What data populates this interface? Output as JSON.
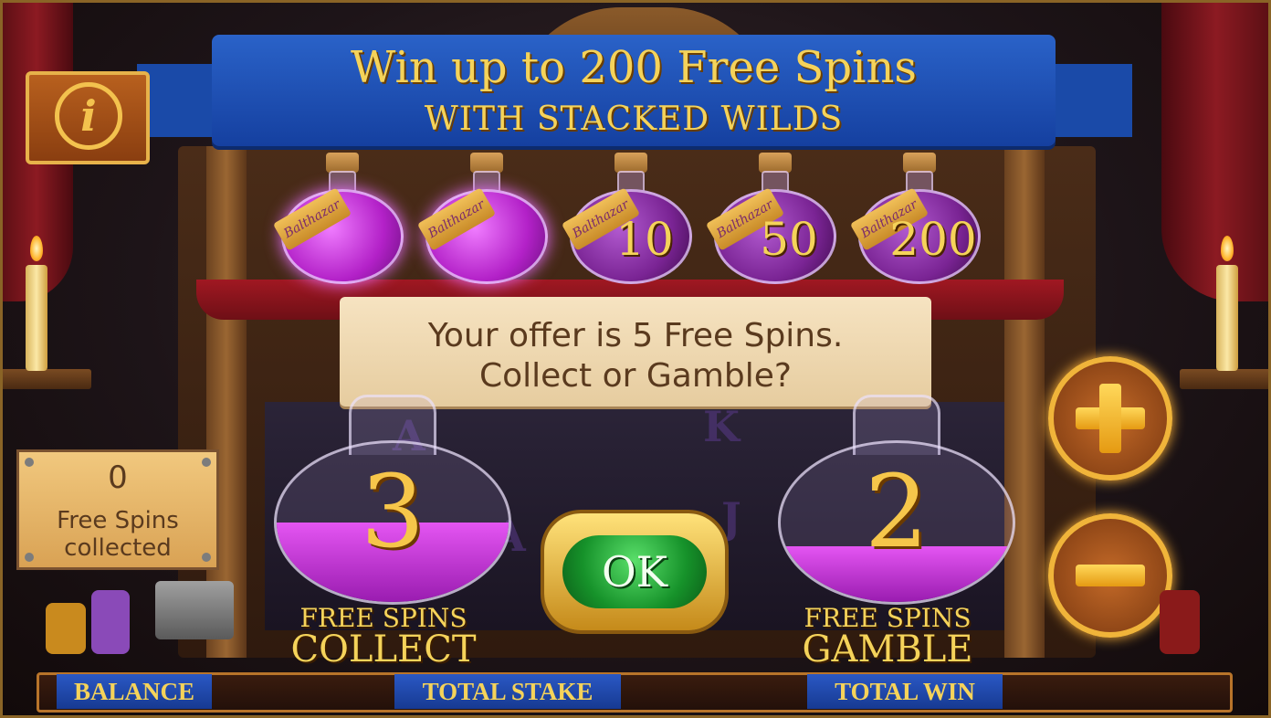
{
  "banner": {
    "title": "Win up to 200 Free Spins",
    "subtitle": "WITH STACKED WILDS"
  },
  "info_button": {
    "symbol": "i",
    "icon": "info-icon"
  },
  "potions": [
    {
      "state": "collected",
      "tag": "Balthazar",
      "value": ""
    },
    {
      "state": "collected",
      "tag": "Balthazar",
      "value": ""
    },
    {
      "state": "available",
      "tag": "Balthazar",
      "value": "10"
    },
    {
      "state": "available",
      "tag": "Balthazar",
      "value": "50"
    },
    {
      "state": "available",
      "tag": "Balthazar",
      "value": "200"
    }
  ],
  "offer": {
    "line1": "Your offer is 5 Free Spins.",
    "line2": "Collect or Gamble?"
  },
  "collect": {
    "value": "3",
    "liquid_level": 0.5,
    "label_top": "FREE SPINS",
    "label_bottom": "COLLECT"
  },
  "gamble": {
    "value": "2",
    "liquid_level": 0.35,
    "label_top": "FREE SPINS",
    "label_bottom": "GAMBLE"
  },
  "ok_button": {
    "label": "OK"
  },
  "plus_button": {
    "icon": "plus-icon"
  },
  "minus_button": {
    "icon": "minus-icon"
  },
  "counter": {
    "value": "0",
    "line1": "Free Spins",
    "line2": "collected"
  },
  "bottom_bar": {
    "balance_label": "BALANCE",
    "balance_value": "",
    "stake_label": "TOTAL STAKE",
    "stake_value": "",
    "win_label": "TOTAL WIN",
    "win_value": ""
  },
  "colors": {
    "gold_text": "#f5d35a",
    "banner_blue": "#1a4aa8",
    "potion_purple": "#b321c8",
    "ok_green": "#16922a"
  }
}
